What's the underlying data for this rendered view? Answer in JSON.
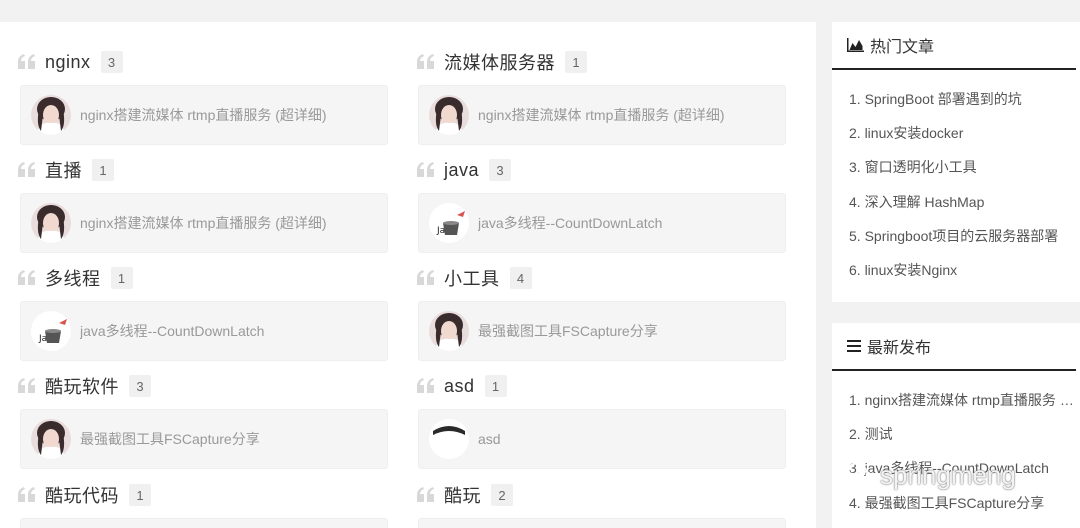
{
  "tags": [
    {
      "name": "nginx",
      "count": "3",
      "posts": [
        {
          "title": "nginx搭建流媒体 rtmp直播服务 (超详细)",
          "thumb": "girl-avatar"
        }
      ]
    },
    {
      "name": "流媒体服务器",
      "count": "1",
      "posts": [
        {
          "title": "nginx搭建流媒体 rtmp直播服务 (超详细)",
          "thumb": "girl-avatar"
        }
      ]
    },
    {
      "name": "直播",
      "count": "1",
      "posts": [
        {
          "title": "nginx搭建流媒体 rtmp直播服务 (超详细)",
          "thumb": "girl-avatar"
        }
      ]
    },
    {
      "name": "java",
      "count": "3",
      "posts": [
        {
          "title": "java多线程--CountDownLatch",
          "thumb": "java-avatar"
        }
      ]
    },
    {
      "name": "多线程",
      "count": "1",
      "posts": [
        {
          "title": "java多线程--CountDownLatch",
          "thumb": "java-avatar"
        }
      ]
    },
    {
      "name": "小工具",
      "count": "4",
      "posts": [
        {
          "title": "最强截图工具FSCapture分享",
          "thumb": "girl-avatar"
        }
      ]
    },
    {
      "name": "酷玩软件",
      "count": "3",
      "posts": [
        {
          "title": "最强截图工具FSCapture分享",
          "thumb": "girl-avatar"
        }
      ]
    },
    {
      "name": "asd",
      "count": "1",
      "posts": [
        {
          "title": "asd",
          "thumb": "dark-avatar"
        }
      ]
    },
    {
      "name": "酷玩代码",
      "count": "1",
      "posts": []
    },
    {
      "name": "酷玩",
      "count": "2",
      "posts": []
    }
  ],
  "hot": {
    "title": "热门文章",
    "icon": "area-chart-icon",
    "items": [
      "1. SpringBoot 部署遇到的坑",
      "2. linux安装docker",
      "3. 窗口透明化小工具",
      "4. 深入理解 HashMap",
      "5. Springboot项目的云服务器部署",
      "6. linux安装Nginx"
    ]
  },
  "latest": {
    "title": "最新发布",
    "icon": "list-icon",
    "items": [
      "1. nginx搭建流媒体 rtmp直播服务 (...",
      "2. 测试",
      "3. java多线程--CountDownLatch",
      "4. 最强截图工具FSCapture分享"
    ]
  },
  "watermark": "springmeng",
  "colors": {
    "accent": "#222222",
    "muted": "#999999",
    "card": "#f5f5f5"
  }
}
